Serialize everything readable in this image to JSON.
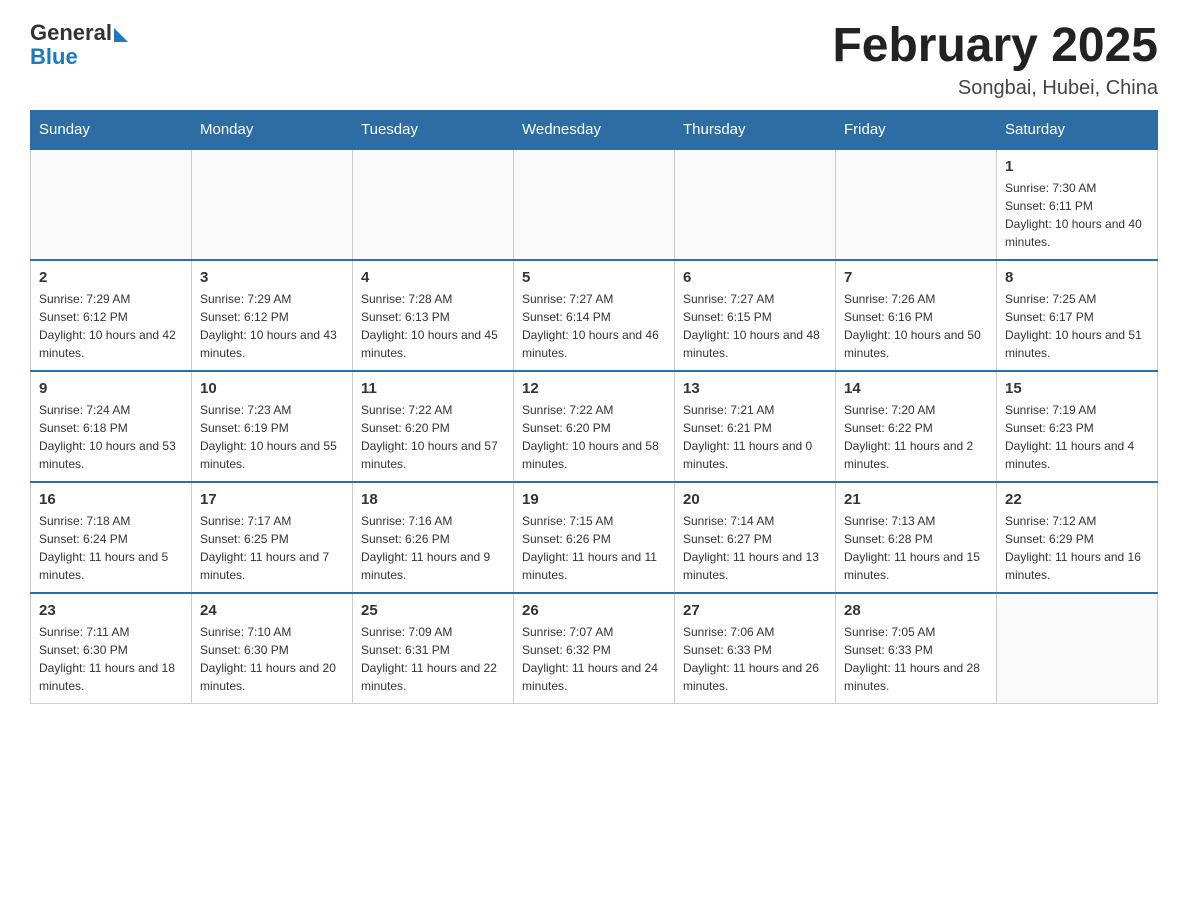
{
  "header": {
    "logo_general": "General",
    "logo_blue": "Blue",
    "month_title": "February 2025",
    "location": "Songbai, Hubei, China"
  },
  "weekdays": [
    "Sunday",
    "Monday",
    "Tuesday",
    "Wednesday",
    "Thursday",
    "Friday",
    "Saturday"
  ],
  "weeks": [
    [
      {
        "day": "",
        "info": ""
      },
      {
        "day": "",
        "info": ""
      },
      {
        "day": "",
        "info": ""
      },
      {
        "day": "",
        "info": ""
      },
      {
        "day": "",
        "info": ""
      },
      {
        "day": "",
        "info": ""
      },
      {
        "day": "1",
        "info": "Sunrise: 7:30 AM\nSunset: 6:11 PM\nDaylight: 10 hours and 40 minutes."
      }
    ],
    [
      {
        "day": "2",
        "info": "Sunrise: 7:29 AM\nSunset: 6:12 PM\nDaylight: 10 hours and 42 minutes."
      },
      {
        "day": "3",
        "info": "Sunrise: 7:29 AM\nSunset: 6:12 PM\nDaylight: 10 hours and 43 minutes."
      },
      {
        "day": "4",
        "info": "Sunrise: 7:28 AM\nSunset: 6:13 PM\nDaylight: 10 hours and 45 minutes."
      },
      {
        "day": "5",
        "info": "Sunrise: 7:27 AM\nSunset: 6:14 PM\nDaylight: 10 hours and 46 minutes."
      },
      {
        "day": "6",
        "info": "Sunrise: 7:27 AM\nSunset: 6:15 PM\nDaylight: 10 hours and 48 minutes."
      },
      {
        "day": "7",
        "info": "Sunrise: 7:26 AM\nSunset: 6:16 PM\nDaylight: 10 hours and 50 minutes."
      },
      {
        "day": "8",
        "info": "Sunrise: 7:25 AM\nSunset: 6:17 PM\nDaylight: 10 hours and 51 minutes."
      }
    ],
    [
      {
        "day": "9",
        "info": "Sunrise: 7:24 AM\nSunset: 6:18 PM\nDaylight: 10 hours and 53 minutes."
      },
      {
        "day": "10",
        "info": "Sunrise: 7:23 AM\nSunset: 6:19 PM\nDaylight: 10 hours and 55 minutes."
      },
      {
        "day": "11",
        "info": "Sunrise: 7:22 AM\nSunset: 6:20 PM\nDaylight: 10 hours and 57 minutes."
      },
      {
        "day": "12",
        "info": "Sunrise: 7:22 AM\nSunset: 6:20 PM\nDaylight: 10 hours and 58 minutes."
      },
      {
        "day": "13",
        "info": "Sunrise: 7:21 AM\nSunset: 6:21 PM\nDaylight: 11 hours and 0 minutes."
      },
      {
        "day": "14",
        "info": "Sunrise: 7:20 AM\nSunset: 6:22 PM\nDaylight: 11 hours and 2 minutes."
      },
      {
        "day": "15",
        "info": "Sunrise: 7:19 AM\nSunset: 6:23 PM\nDaylight: 11 hours and 4 minutes."
      }
    ],
    [
      {
        "day": "16",
        "info": "Sunrise: 7:18 AM\nSunset: 6:24 PM\nDaylight: 11 hours and 5 minutes."
      },
      {
        "day": "17",
        "info": "Sunrise: 7:17 AM\nSunset: 6:25 PM\nDaylight: 11 hours and 7 minutes."
      },
      {
        "day": "18",
        "info": "Sunrise: 7:16 AM\nSunset: 6:26 PM\nDaylight: 11 hours and 9 minutes."
      },
      {
        "day": "19",
        "info": "Sunrise: 7:15 AM\nSunset: 6:26 PM\nDaylight: 11 hours and 11 minutes."
      },
      {
        "day": "20",
        "info": "Sunrise: 7:14 AM\nSunset: 6:27 PM\nDaylight: 11 hours and 13 minutes."
      },
      {
        "day": "21",
        "info": "Sunrise: 7:13 AM\nSunset: 6:28 PM\nDaylight: 11 hours and 15 minutes."
      },
      {
        "day": "22",
        "info": "Sunrise: 7:12 AM\nSunset: 6:29 PM\nDaylight: 11 hours and 16 minutes."
      }
    ],
    [
      {
        "day": "23",
        "info": "Sunrise: 7:11 AM\nSunset: 6:30 PM\nDaylight: 11 hours and 18 minutes."
      },
      {
        "day": "24",
        "info": "Sunrise: 7:10 AM\nSunset: 6:30 PM\nDaylight: 11 hours and 20 minutes."
      },
      {
        "day": "25",
        "info": "Sunrise: 7:09 AM\nSunset: 6:31 PM\nDaylight: 11 hours and 22 minutes."
      },
      {
        "day": "26",
        "info": "Sunrise: 7:07 AM\nSunset: 6:32 PM\nDaylight: 11 hours and 24 minutes."
      },
      {
        "day": "27",
        "info": "Sunrise: 7:06 AM\nSunset: 6:33 PM\nDaylight: 11 hours and 26 minutes."
      },
      {
        "day": "28",
        "info": "Sunrise: 7:05 AM\nSunset: 6:33 PM\nDaylight: 11 hours and 28 minutes."
      },
      {
        "day": "",
        "info": ""
      }
    ]
  ]
}
